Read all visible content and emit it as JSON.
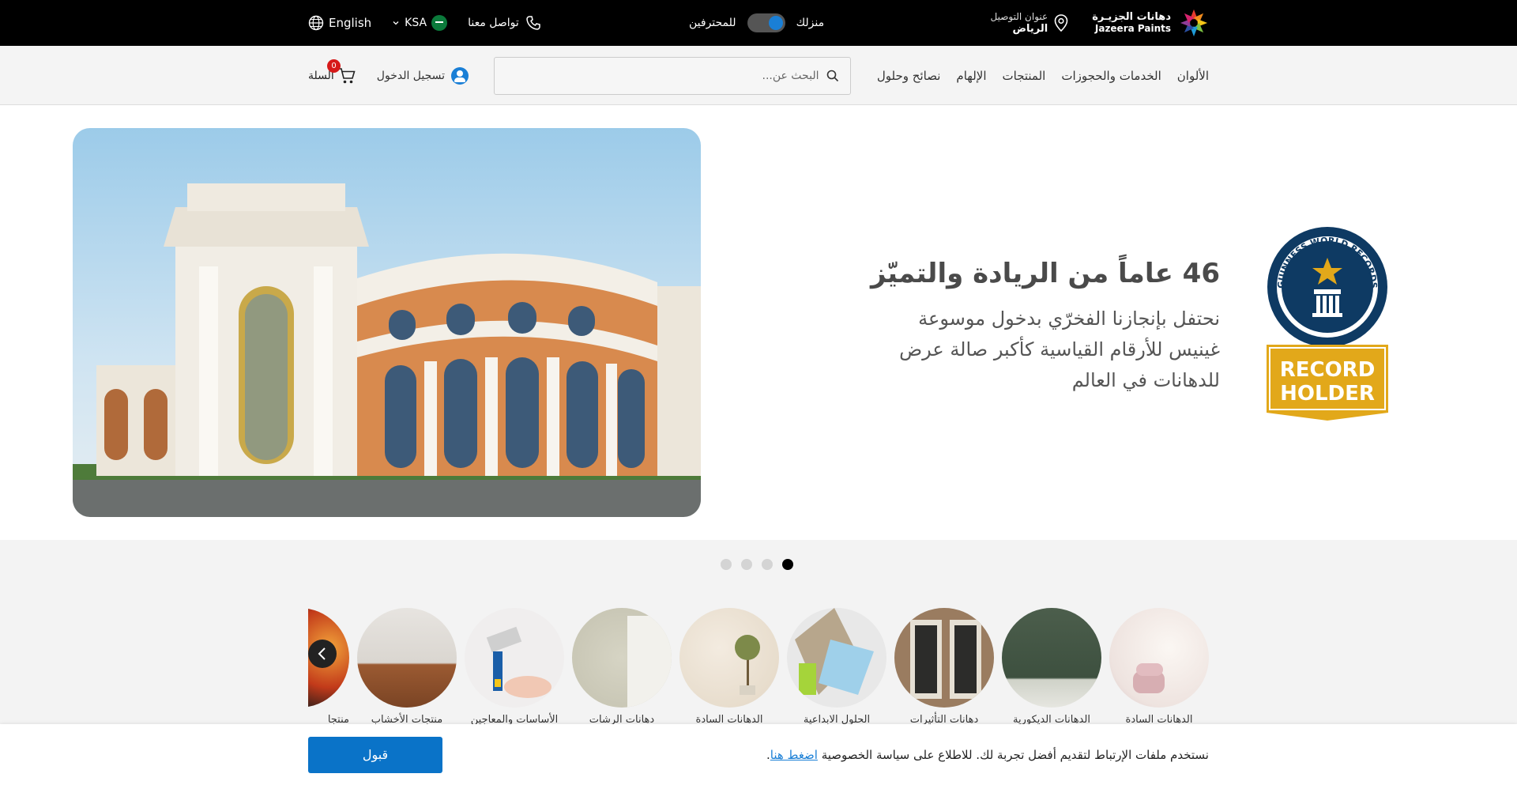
{
  "topbar": {
    "brand_ar": "دهانات الجزيـرة",
    "brand_en": "Jazeera Paints",
    "address_label": "عنوان التوصيل",
    "address_city": "الرياض",
    "mode_home": "منزلك",
    "mode_pro": "للمحترفين",
    "contact": "تواصل معنا",
    "country": "KSA",
    "language": "English"
  },
  "nav": {
    "menu": [
      "الألوان",
      "الخدمات والحجوزات",
      "المنتجات",
      "الإلهام",
      "نصائح وحلول"
    ],
    "search_placeholder": "البحث عن...",
    "login": "تسجيل الدخول",
    "cart_label": "السلة",
    "cart_count": "0"
  },
  "hero": {
    "title": "46 عاماً من الريادة والتميّز",
    "subtitle_lines": [
      "نحتفل بإنجازنا الفخرّي بدخول موسوعة",
      "غينيس للأرقام القياسية كأكبر صالة عرض",
      "للدهانات في العالم"
    ],
    "badge_top": "GUINNESS WORLD RECORDS",
    "badge_bottom_1": "RECORD",
    "badge_bottom_2": "HOLDER",
    "slides_count": 4,
    "active_slide": 1
  },
  "categories": [
    {
      "label": "الدهانات السادة"
    },
    {
      "label": "الدهانات الديكورية"
    },
    {
      "label": "دهانات التأثيرات"
    },
    {
      "label": "الحلول الابداعية"
    },
    {
      "label": "الدهانات السادة"
    },
    {
      "label": "دهانات الرشات"
    },
    {
      "label": "الأساسات والمعاجين"
    },
    {
      "label": "منتجات الأخشاب"
    },
    {
      "label": "منتجا"
    }
  ],
  "cookie": {
    "text": "نستخدم ملفات الإرتباط لتقديم أفضل تجربة لك. للاطلاع على سياسة الخصوصية",
    "link": "اضغط هنا",
    "period": ".",
    "accept": "قبول"
  },
  "colors": {
    "accent": "#0a73c8",
    "topbar_bg": "#000000",
    "cart_badge": "#d61a1a",
    "guinness_blue": "#0e3a63",
    "guinness_gold": "#e2a81a"
  }
}
